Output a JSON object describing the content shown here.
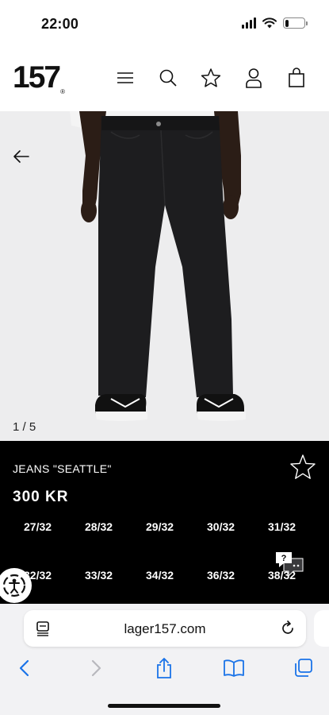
{
  "status_bar": {
    "time": "22:00",
    "icons": [
      "signal-icon",
      "wifi-icon",
      "battery-icon"
    ],
    "battery_level_percent": 20
  },
  "header": {
    "logo_text": "157",
    "logo_mark": "®",
    "icons": [
      "menu-icon",
      "search-icon",
      "star-icon",
      "user-icon",
      "bag-icon"
    ]
  },
  "gallery": {
    "counter": "1 / 5",
    "back_icon": "arrow-left-icon",
    "background_color": "#ededee"
  },
  "product": {
    "name": "JEANS \"SEATTLE\"",
    "price": "300 KR",
    "favorite_icon": "star-outline-icon",
    "sizes": [
      "27/32",
      "28/32",
      "29/32",
      "30/32",
      "31/32",
      "32/32",
      "33/32",
      "34/32",
      "36/32",
      "38/32"
    ],
    "panel_color": "#000000"
  },
  "widgets": {
    "chat_icon": "chat-help-icon",
    "chat_label": "?",
    "accessibility_icon": "accessibility-icon"
  },
  "browser": {
    "url": "lager157.com",
    "reader_icon": "page-menu-icon",
    "reload_icon": "reload-icon",
    "toolbar": [
      "back-icon",
      "forward-icon",
      "share-icon",
      "bookmarks-icon",
      "tabs-icon"
    ],
    "accent_color": "#1a73e8"
  }
}
